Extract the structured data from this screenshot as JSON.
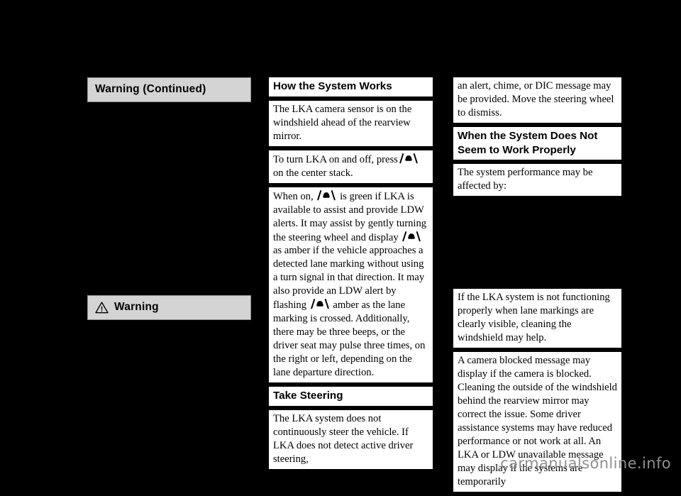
{
  "page": {
    "background_color": "#000000",
    "text_color": "#000000",
    "block_background": "#ffffff",
    "warning_bar_color": "#d4d4d4",
    "warning_bar_border": "#8e8e8e"
  },
  "left_column": {
    "warning_continued_label": "Warning  (Continued)",
    "warning_label": "Warning",
    "warning_icon": "warning-triangle-icon"
  },
  "middle_column": {
    "heading_how_it_works": "How the System Works",
    "para_camera_sensor": "The LKA camera sensor is on the windshield ahead of the rearview mirror.",
    "para_turn_on_off_pre": "To turn LKA on and off, press",
    "para_turn_on_off_post": "on the center stack.",
    "para_when_on_1": "When on,",
    "para_when_on_2": "is green if LKA is available to assist and provide LDW alerts. It may assist by gently turning the steering wheel and display",
    "para_when_on_3": "as amber if the vehicle approaches a detected lane marking without using a turn signal in that direction. It may also provide an LDW alert by flashing",
    "para_when_on_4": "amber as the lane marking is crossed. Additionally, there may be three beeps, or the driver seat may pulse three times, on the right or left, depending on the lane departure direction.",
    "heading_take_steering": "Take Steering",
    "para_take_steering": "The LKA system does not continuously steer the vehicle. If LKA does not detect active driver steering,",
    "lka_icon_name": "lka-lane-keep-assist-icon"
  },
  "right_column": {
    "para_alert_continued": "an alert, chime, or DIC message may be provided. Move the steering wheel to dismiss.",
    "heading_not_working": "When the System Does Not Seem to Work Properly",
    "para_performance_affected": "The system performance may be affected by:",
    "para_not_functioning": "If the LKA system is not functioning properly when lane markings are clearly visible, cleaning the windshield may help.",
    "para_camera_blocked": "A camera blocked message may display if the camera is blocked. Cleaning the outside of the windshield behind the rearview mirror may correct the issue. Some driver assistance systems may have reduced performance or not work at all. An LKA or LDW unavailable message may display if the systems are temporarily"
  },
  "footer": {
    "watermark": "carmanualsonline.info"
  }
}
